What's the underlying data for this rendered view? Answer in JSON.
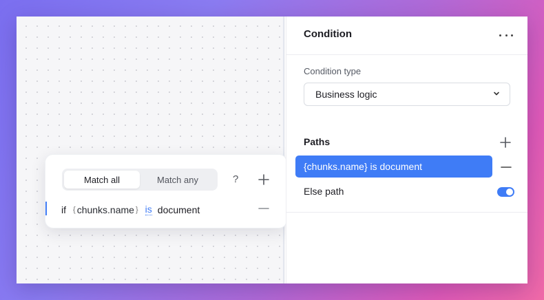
{
  "panel": {
    "title": "Condition",
    "condition_type_label": "Condition type",
    "condition_type_value": "Business logic",
    "paths_label": "Paths",
    "paths": [
      {
        "label": "{chunks.name} is document",
        "selected": true
      }
    ],
    "else_path_label": "Else path",
    "else_path_enabled": true
  },
  "card": {
    "match_all_label": "Match all",
    "match_any_label": "Match any",
    "active_mode": "Match all",
    "help_label": "?",
    "condition": {
      "if_label": "if",
      "variable": "chunks.name",
      "operator": "is",
      "value": "document"
    }
  },
  "colors": {
    "accent": "#3f7cf6",
    "gradient_start": "#7b6ff0",
    "gradient_end": "#f06aa8"
  }
}
